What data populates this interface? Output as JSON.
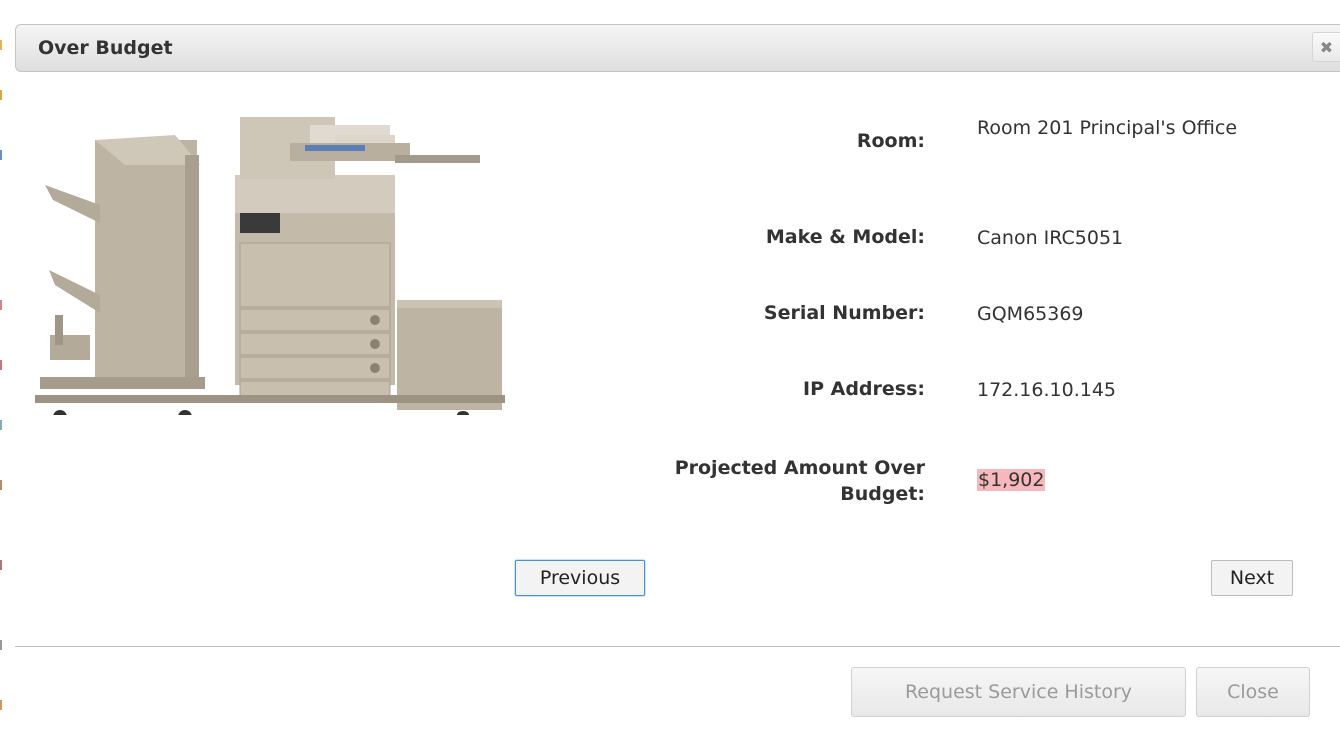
{
  "dialog": {
    "title": "Over Budget",
    "close_icon": "close-icon"
  },
  "device": {
    "image_icon": "printer-image",
    "fields": [
      {
        "label": "Room:",
        "value": "Room 201 Principal's Office"
      },
      {
        "label": "Make & Model:",
        "value": "Canon IRC5051"
      },
      {
        "label": "Serial Number:",
        "value": "GQM65369"
      },
      {
        "label": "IP Address:",
        "value": "172.16.10.145"
      },
      {
        "label": "Projected Amount Over Budget:",
        "value": "$1,902"
      }
    ],
    "highlight_color": "#f6b8bd"
  },
  "nav": {
    "previous_label": "Previous",
    "next_label": "Next"
  },
  "footer": {
    "request_label": "Request Service History",
    "close_label": "Close"
  }
}
